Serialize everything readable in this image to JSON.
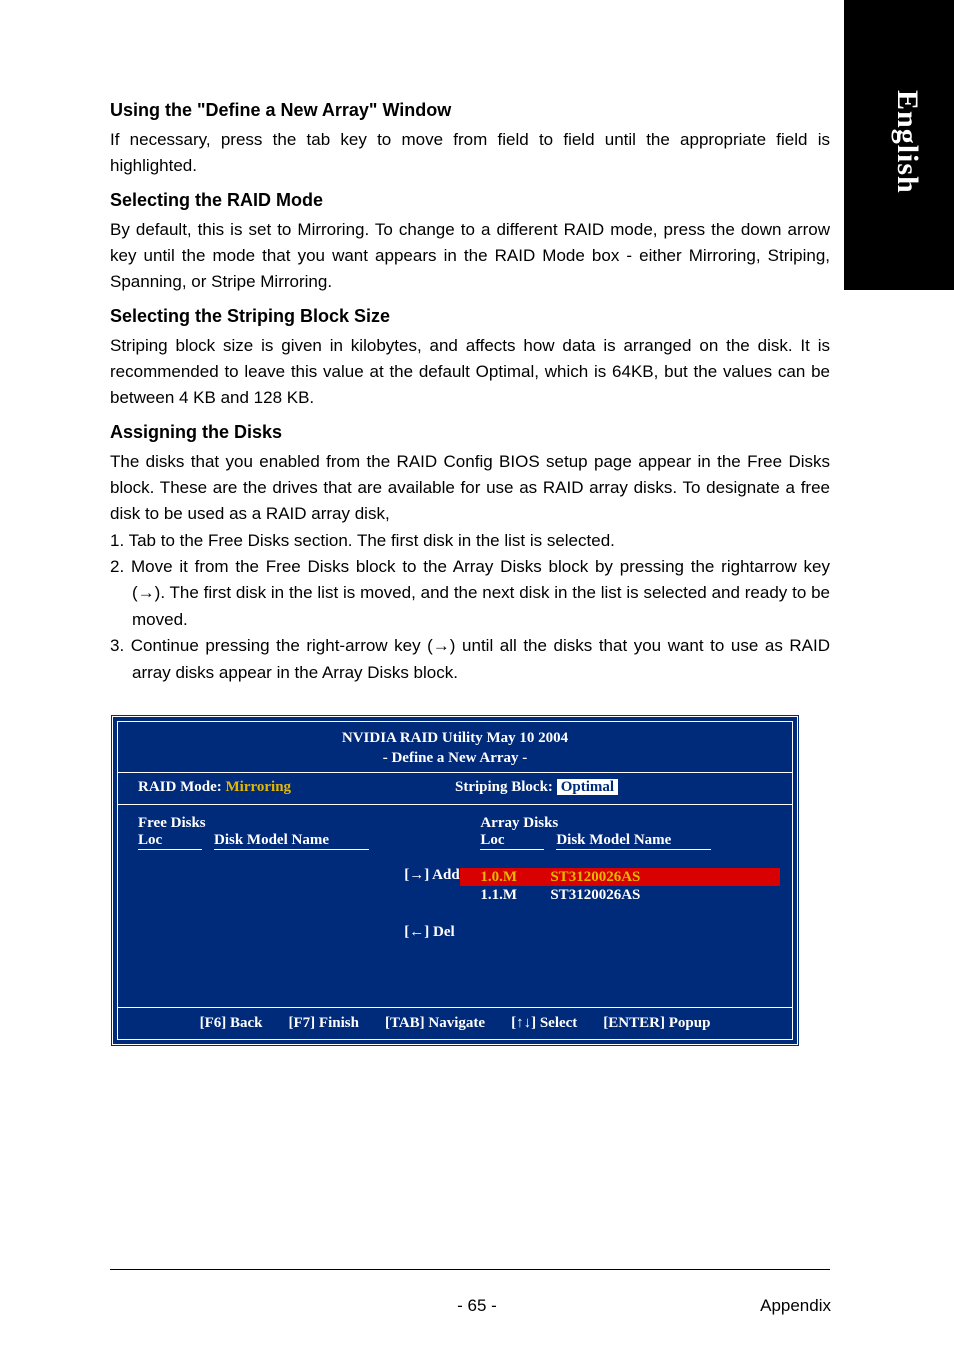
{
  "language_tab": "English",
  "sections": {
    "s1": {
      "title": "Using the \"Define a New Array\" Window",
      "body": "If necessary, press the tab key to move from field to field until the appropriate field is highlighted."
    },
    "s2": {
      "title": "Selecting the RAID Mode",
      "body": "By default, this is set to Mirroring. To change to a different RAID mode, press the down arrow key until the mode that you want appears in the RAID Mode box - either Mirroring, Striping, Spanning, or Stripe Mirroring."
    },
    "s3": {
      "title": "Selecting the Striping Block Size",
      "body": "Striping block size is given in kilobytes, and affects how data is arranged on the disk. It is recommended to leave this value at the default Optimal, which is 64KB, but the values can be between 4 KB and 128 KB."
    },
    "s4": {
      "title": "Assigning the Disks",
      "body": "The disks that you enabled from the RAID Config BIOS setup page appear in the Free Disks block. These are the drives that are available for use as RAID array disks. To designate a free disk to be used as a RAID array disk,",
      "steps": {
        "i1": "1. Tab to the Free Disks section. The first disk in the list is selected.",
        "i2": "2. Move it from the Free Disks block to the Array Disks block by pressing the rightarrow key (→). The first disk in the list is moved, and the next disk in the list is selected and ready to be moved.",
        "i3": "3. Continue pressing the right-arrow key (→) until all the disks that you want to use as RAID array disks appear in the Array Disks block."
      }
    }
  },
  "bios": {
    "title_line1": "NVIDIA RAID Utility   May 10 2004",
    "title_line2": "- Define a New Array -",
    "raid_mode_label": "RAID Mode:",
    "raid_mode_value": "Mirroring",
    "striping_label": "Striping Block:",
    "striping_value": "Optimal",
    "free_disks_label": "Free Disks",
    "array_disks_label": "Array Disks",
    "col_loc": "Loc",
    "col_model": "Disk Model Name",
    "add_btn": "[→] Add",
    "del_btn": "[←] Del",
    "array_rows": {
      "r0": {
        "loc": "1.0.M",
        "model": "ST3120026AS"
      },
      "r1": {
        "loc": "1.1.M",
        "model": "ST3120026AS"
      }
    },
    "footer": {
      "f6": "[F6] Back",
      "f7": "[F7] Finish",
      "tab": "[TAB] Navigate",
      "sel": "[↑↓] Select",
      "enter": "[ENTER] Popup"
    }
  },
  "footer": {
    "page": "- 65 -",
    "section": "Appendix"
  }
}
